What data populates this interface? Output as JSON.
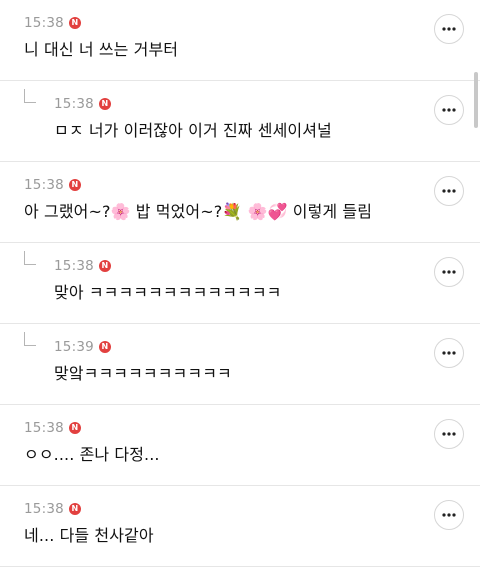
{
  "comments": [
    {
      "time": "15:38",
      "badge": "N",
      "text": "니 대신 너 쓰는 거부터",
      "is_reply": false
    },
    {
      "time": "15:38",
      "badge": "N",
      "text": "ㅁㅈ 너가 이러잖아 이거 진짜 센세이셔널",
      "is_reply": true
    },
    {
      "time": "15:38",
      "badge": "N",
      "text": "아 그랬어~?🌸 밥 먹었어~?💐 🌸💞 이렇게 들림",
      "is_reply": false
    },
    {
      "time": "15:38",
      "badge": "N",
      "text": "맞아 ㅋㅋㅋㅋㅋㅋㅋㅋㅋㅋㅋㅋㅋ",
      "is_reply": true
    },
    {
      "time": "15:39",
      "badge": "N",
      "text": "맞앜ㅋㅋㅋㅋㅋㅋㅋㅋㅋㅋ",
      "is_reply": true
    },
    {
      "time": "15:38",
      "badge": "N",
      "text": "ㅇㅇ.... 존나 다정...",
      "is_reply": false
    },
    {
      "time": "15:38",
      "badge": "N",
      "text": "네... 다들 천사같아",
      "is_reply": false
    }
  ],
  "icons": {
    "more": "more-horizontal-icon",
    "reply": "reply-arrow-icon"
  },
  "colors": {
    "badge": "#e2403f",
    "time": "#9a9a9a",
    "divider": "#e6e6e6"
  }
}
